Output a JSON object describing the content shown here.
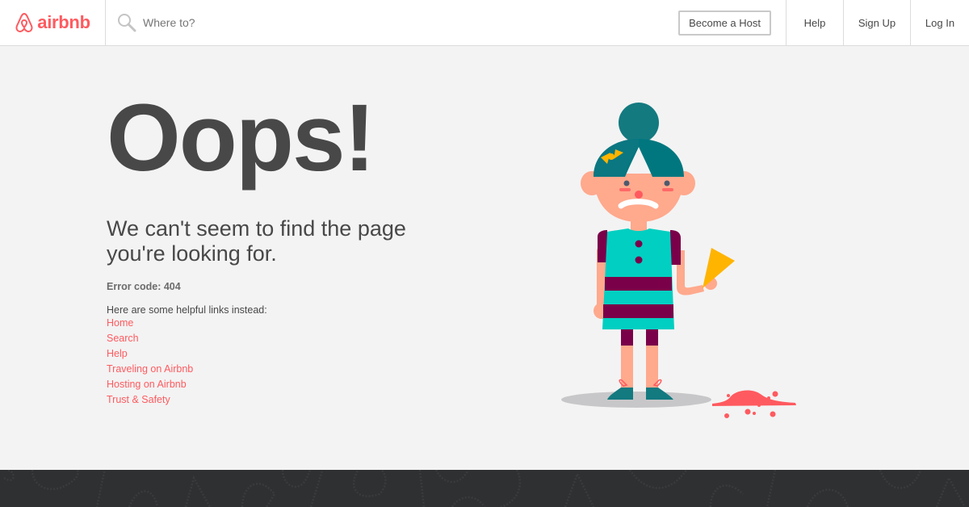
{
  "header": {
    "brand": "airbnb",
    "search_placeholder": "Where to?",
    "search_value": "",
    "become_host_label": "Become a Host",
    "nav": [
      {
        "label": "Help"
      },
      {
        "label": "Sign Up"
      },
      {
        "label": "Log In"
      }
    ]
  },
  "main": {
    "heading": "Oops!",
    "subtitle_line1": "We can't seem to find the page",
    "subtitle_line2": "you're looking for.",
    "error_code": "Error code: 404",
    "links_intro": "Here are some helpful links instead:",
    "links": [
      {
        "label": "Home"
      },
      {
        "label": "Search"
      },
      {
        "label": "Help"
      },
      {
        "label": "Traveling on Airbnb"
      },
      {
        "label": "Hosting on Airbnb"
      },
      {
        "label": "Trust & Safety"
      }
    ]
  },
  "colors": {
    "brand": "#ff5a5f",
    "text": "#484848",
    "background": "#f3f3f3",
    "footer": "#2f3032",
    "hair": "#137a80",
    "skin": "#ffa98d",
    "dress": "#00cfc1",
    "stripe": "#7a004a",
    "ice_cream_cone": "#ffb400"
  },
  "icons": {
    "logo": "airbnb-belo-icon",
    "search": "search-icon"
  }
}
